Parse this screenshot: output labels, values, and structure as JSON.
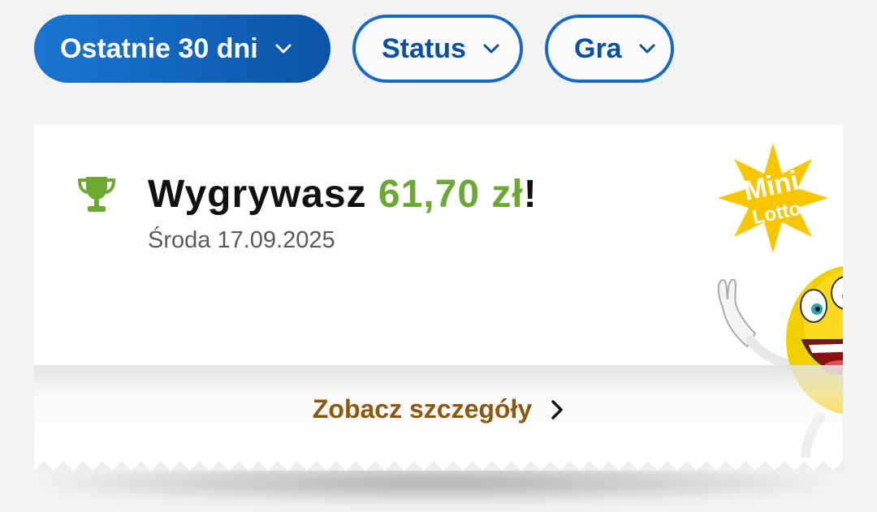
{
  "filters": {
    "period_label": "Ostatnie 30 dni",
    "status_label": "Status",
    "game_label": "Gra"
  },
  "ticket": {
    "title_prefix": "Wygrywasz ",
    "amount": "61,70 zł",
    "title_suffix": "!",
    "date": "Środa 17.09.2025",
    "details_label": "Zobacz szczegóły",
    "game_logo": {
      "line1": "Mini",
      "line2": "Lotto"
    }
  },
  "colors": {
    "primary_blue": "#1869c4",
    "win_green": "#6aaa32",
    "link_brown": "#8a5a10",
    "logo_yellow": "#f7c600"
  },
  "icons": {
    "trophy": "trophy-icon",
    "chevron": "chevron-down-icon",
    "arrow": "chevron-right-icon"
  }
}
